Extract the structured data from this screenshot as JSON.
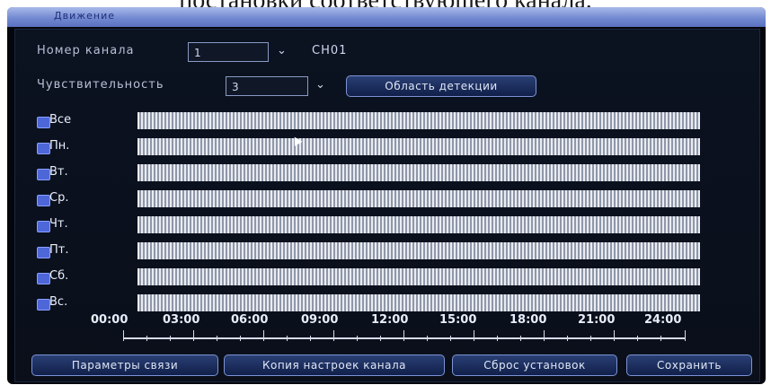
{
  "caption": "постановки соответствующего канала.",
  "window": {
    "title": "Движение"
  },
  "channel": {
    "label": "Номер канала",
    "value": "1",
    "name": "CH01"
  },
  "sensitivity": {
    "label": "Чувствительность",
    "value": "3"
  },
  "detection_area_label": "Область детекции",
  "schedule": {
    "days": [
      "Все",
      "Пн.",
      "Вт.",
      "Ср.",
      "Чт.",
      "Пт.",
      "Сб.",
      "Вс."
    ],
    "times": [
      "00:00",
      "03:00",
      "06:00",
      "09:00",
      "12:00",
      "15:00",
      "18:00",
      "21:00",
      "24:00"
    ]
  },
  "buttons": {
    "link_params": "Параметры связи",
    "copy_channel": "Копия настроек канала",
    "reset": "Сброс установок",
    "save": "Сохранить"
  },
  "colors": {
    "checkbox": "#4d66d8",
    "titlebar": "#6f86cf",
    "background": "#05060c"
  }
}
